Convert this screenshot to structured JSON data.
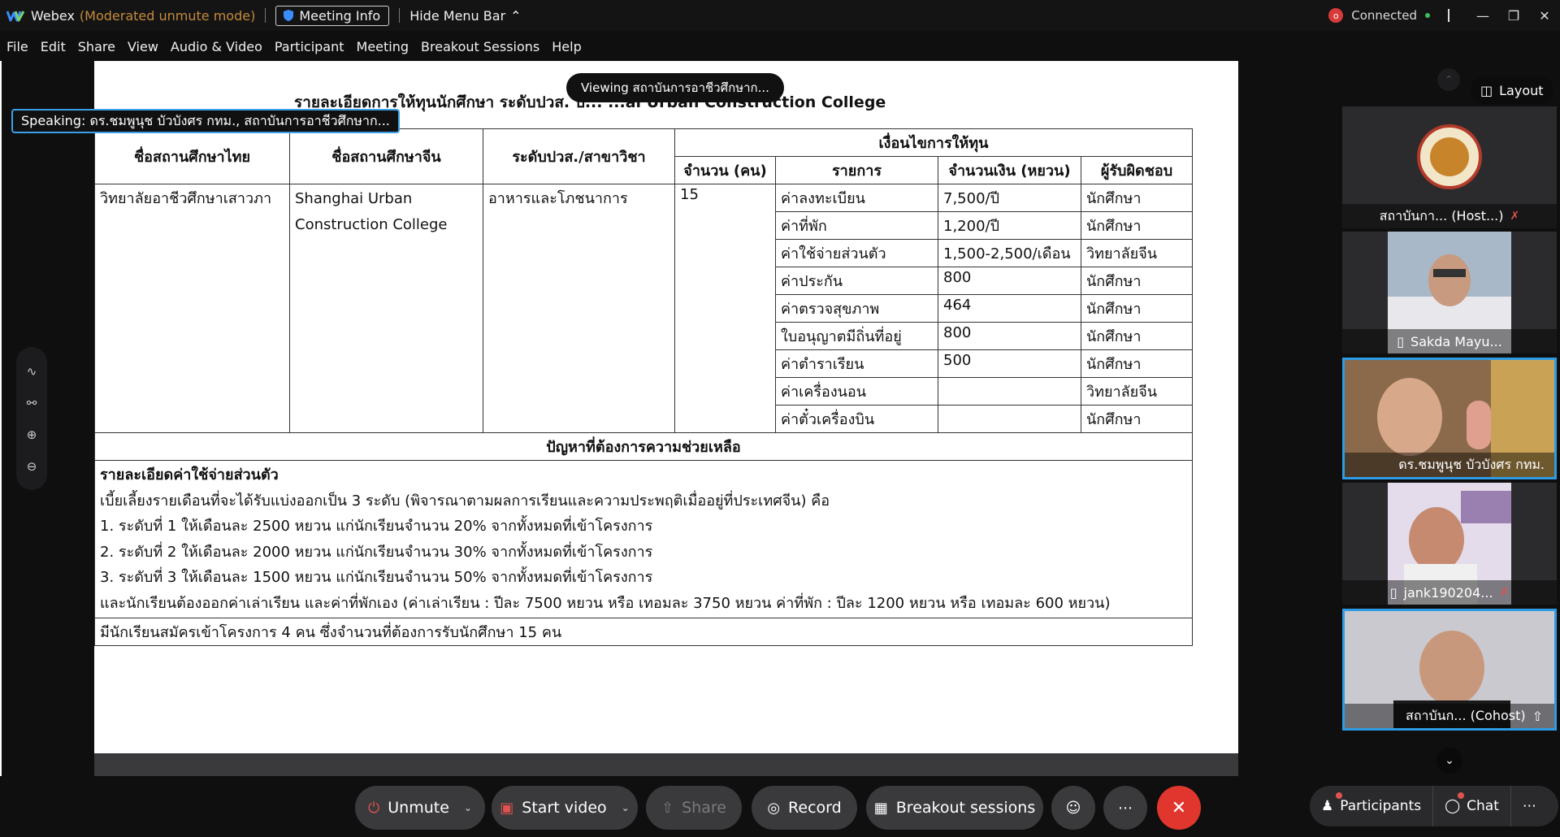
{
  "titlebar": {
    "app_name": "Webex",
    "mode": "(Moderated unmute mode)",
    "meeting_info": "Meeting Info",
    "hide_menu_bar": "Hide Menu Bar",
    "recording_badge": "o",
    "connection_status": "Connected"
  },
  "menu": [
    "File",
    "Edit",
    "Share",
    "View",
    "Audio & Video",
    "Participant",
    "Meeting",
    "Breakout Sessions",
    "Help"
  ],
  "overlay": {
    "viewing": "Viewing สถาบันการอาชีวศึกษาก...",
    "speaking": "Speaking: ดร.ชมพูนุช บัวบังศร กทม., สถาบันการอาชีวศึกษาก..."
  },
  "document": {
    "title": "รายละเอียดการให้ทุนนักศึกษา ระดับปวส. ปี... ...ai Urban Construction College",
    "headers": {
      "thai_school": "ชื่อสถานศึกษาไทย",
      "china_school": "ชื่อสถานศึกษาจีน",
      "level": "ระดับปวส./สาขาวิชา",
      "conditions": "เงื่อนไขการให้ทุน",
      "count": "จำนวน (คน)",
      "item": "รายการ",
      "amount": "จำนวนเงิน (หยวน)",
      "responsible": "ผู้รับผิดชอบ"
    },
    "row": {
      "thai_school": "วิทยาลัยอาชีวศึกษาเสาวภา",
      "china_school_1": "Shanghai Urban",
      "china_school_2": "Construction College",
      "level": "อาหารและโภชนาการ",
      "count": "15"
    },
    "items": [
      {
        "item": "ค่าลงทะเบียน",
        "amount": "7,500/ปี",
        "responsible": "นักศึกษา"
      },
      {
        "item": "ค่าที่พัก",
        "amount": "1,200/ปี",
        "responsible": "นักศึกษา"
      },
      {
        "item": "ค่าใช้จ่ายส่วนตัว",
        "amount": "1,500-2,500/เดือน",
        "responsible": "วิทยาลัยจีน"
      },
      {
        "item": "ค่าประกัน",
        "amount": "800",
        "responsible": "นักศึกษา"
      },
      {
        "item": "ค่าตรวจสุขภาพ",
        "amount": "464",
        "responsible": "นักศึกษา"
      },
      {
        "item": "ใบอนุญาตมีถิ่นที่อยู่",
        "amount": "800",
        "responsible": "นักศึกษา"
      },
      {
        "item": "ค่าตำราเรียน",
        "amount": "500",
        "responsible": "นักศึกษา"
      },
      {
        "item": "ค่าเครื่องนอน",
        "amount": "",
        "responsible": "วิทยาลัยจีน"
      },
      {
        "item": "ค่าตั๋วเครื่องบิน",
        "amount": "",
        "responsible": "นักศึกษา"
      }
    ],
    "problems_header": "ปัญหาที่ต้องการความช่วยเหลือ",
    "notes_title": "รายละเอียดค่าใช้จ่ายส่วนตัว",
    "notes": [
      "เบี้ยเลี้ยงรายเดือนที่จะได้รับแบ่งออกเป็น 3 ระดับ (พิจารณาตามผลการเรียนและความประพฤติเมื่ออยู่ที่ประเทศจีน) คือ",
      "1. ระดับที่ 1 ให้เดือนละ 2500 หยวน แก่นักเรียนจำนวน 20% จากทั้งหมดที่เข้าโครงการ",
      "2. ระดับที่ 2 ให้เดือนละ 2000 หยวน แก่นักเรียนจำนวน 30% จากทั้งหมดที่เข้าโครงการ",
      "3. ระดับที่ 3 ให้เดือนละ 1500 หยวน แก่นักเรียนจำนวน 50% จากทั้งหมดที่เข้าโครงการ",
      "และนักเรียนต้องออกค่าเล่าเรียน และค่าที่พักเอง (ค่าเล่าเรียน : ปีละ 7500 หยวน หรือ เทอมละ 3750 หยวน ค่าที่พัก : ปีละ 1200 หยวน หรือ เทอมละ 600 หยวน)"
    ],
    "footer_note": "มีนักเรียนสมัครเข้าโครงการ 4 คน ซึ่งจำนวนที่ต้องการรับนักศึกษา 15 คน"
  },
  "participants": [
    {
      "label": "สถาบันกา... (Host...)",
      "muted": true,
      "color": "#2b2b2d"
    },
    {
      "label": "Sakda Mayu...",
      "muted": false,
      "color": "#5f7e9c"
    },
    {
      "label": "ดร.ชมพูนุช บัวบังศร กทม.",
      "muted": false,
      "color": "#8a6a4a"
    },
    {
      "label": "jank190204...",
      "muted": true,
      "color": "#b7a9c4"
    },
    {
      "label": "สถาบันก... (Cohost)",
      "muted": false,
      "color": "#c9c9cf"
    }
  ],
  "layout_button": "Layout",
  "controls": {
    "unmute": "Unmute",
    "start_video": "Start video",
    "share": "Share",
    "record": "Record",
    "breakout": "Breakout sessions",
    "participants": "Participants",
    "chat": "Chat"
  },
  "icons": {
    "mic_muted": "mic-muted-icon",
    "video": "video-icon",
    "share": "share-icon",
    "record": "record-icon",
    "breakout": "breakout-icon",
    "reactions": "reactions-icon",
    "more": "more-icon",
    "end": "end-call-icon"
  },
  "colors": {
    "accent_blue": "#2f9be3",
    "end_red": "#e0362e",
    "mode_orange": "#c48a3c"
  }
}
